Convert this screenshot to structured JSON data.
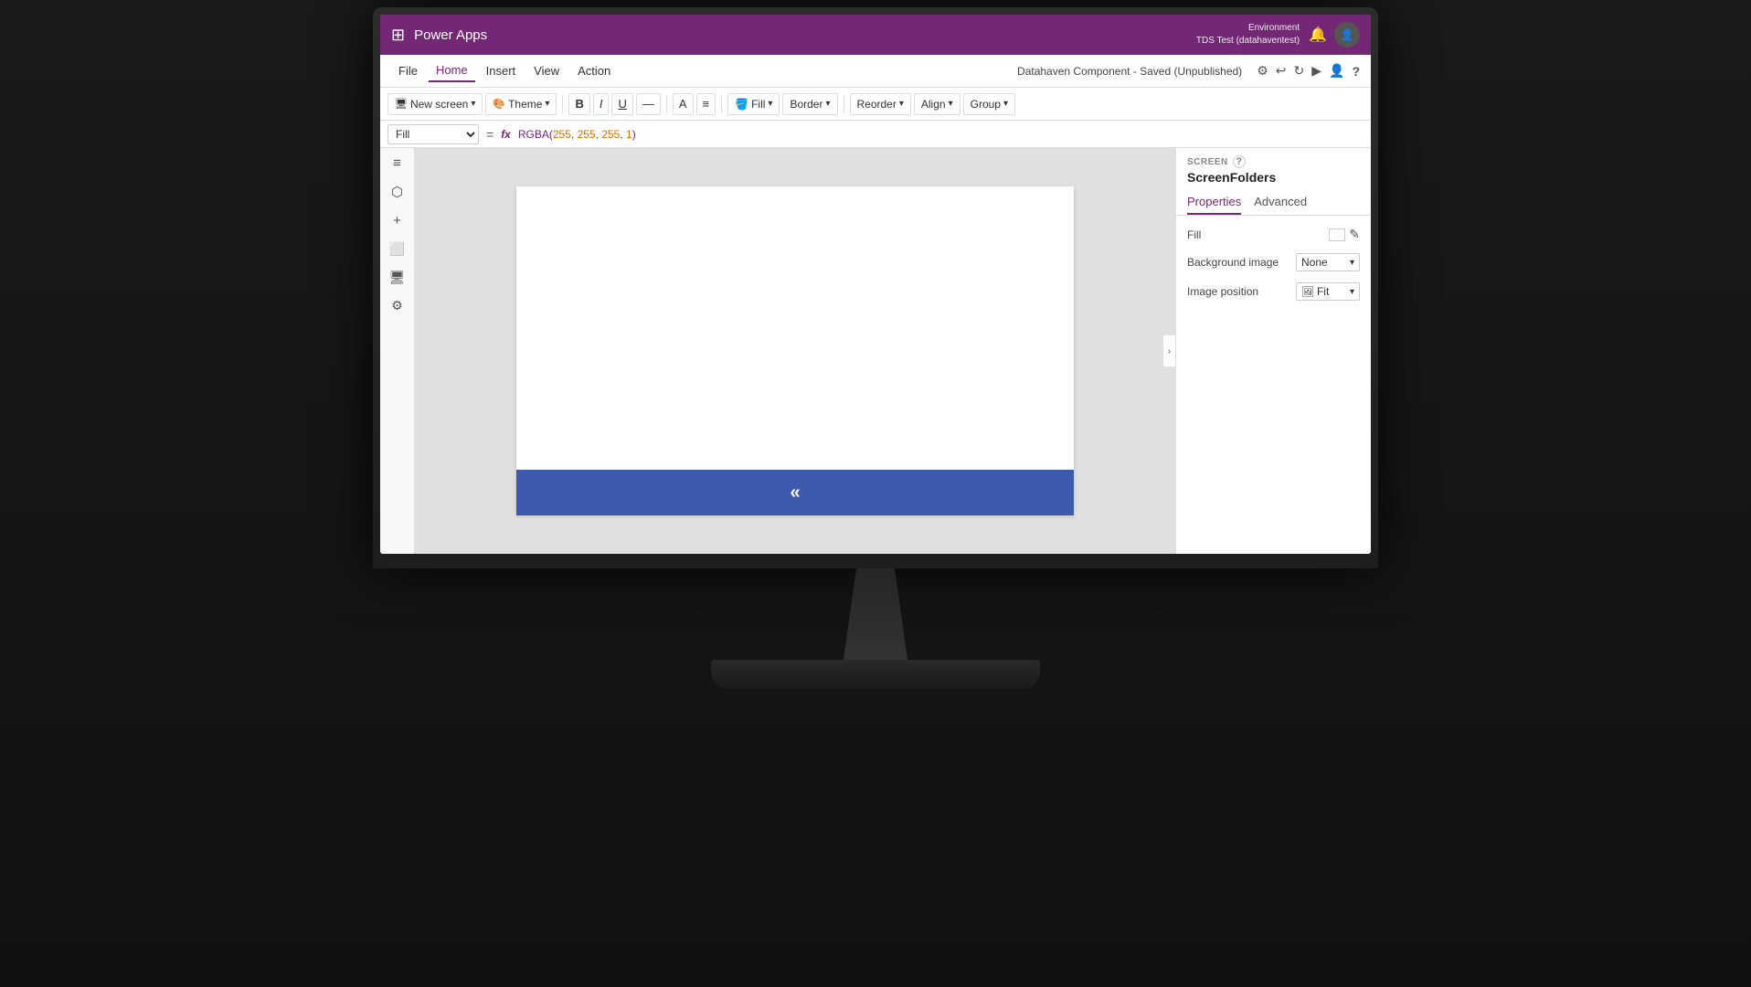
{
  "app": {
    "name": "Power Apps",
    "waffle": "⊞"
  },
  "titlebar": {
    "env_label": "Environment",
    "env_name": "TDS Test (datahaventest)",
    "bell": "🔔"
  },
  "menubar": {
    "items": [
      "File",
      "Home",
      "Insert",
      "View",
      "Action"
    ],
    "active": "Home",
    "save_status": "Datahaven Component - Saved (Unpublished)"
  },
  "toolbar": {
    "new_screen": "New screen",
    "new_screen_chevron": "▾",
    "theme": "Theme",
    "theme_chevron": "▾",
    "bold": "B",
    "italic": "I",
    "underline": "U",
    "strikethrough": "—",
    "font_color": "A",
    "align": "≡",
    "fill": "Fill",
    "fill_chevron": "▾",
    "border": "Border",
    "border_chevron": "▾",
    "reorder": "Reorder",
    "reorder_chevron": "▾",
    "align_btn": "Align",
    "align_chevron": "▾",
    "group": "Group",
    "group_chevron": "▾"
  },
  "formula_bar": {
    "property": "Fill",
    "equals": "=",
    "fx": "fx",
    "formula": "RGBA(255, 255, 255, 1)"
  },
  "sidebar": {
    "icons": [
      "≡",
      "⬡",
      "+",
      "⬜",
      "🖥",
      "⚙"
    ]
  },
  "canvas": {
    "blue_bar_text": "«"
  },
  "right_panel": {
    "screen_label": "SCREEN",
    "help": "?",
    "title": "ScreenFolders",
    "tabs": [
      "Properties",
      "Advanced"
    ],
    "active_tab": "Properties",
    "fill_label": "Fill",
    "background_image_label": "Background image",
    "background_image_value": "None",
    "image_position_label": "Image position",
    "image_position_value": "Fit",
    "image_position_icon": "🖼"
  },
  "icons": {
    "undo": "↩",
    "redo": "↻",
    "play": "▶",
    "person": "👤",
    "help": "?",
    "chevron_right": "›",
    "chevron_down": "▾",
    "edit": "✎"
  }
}
